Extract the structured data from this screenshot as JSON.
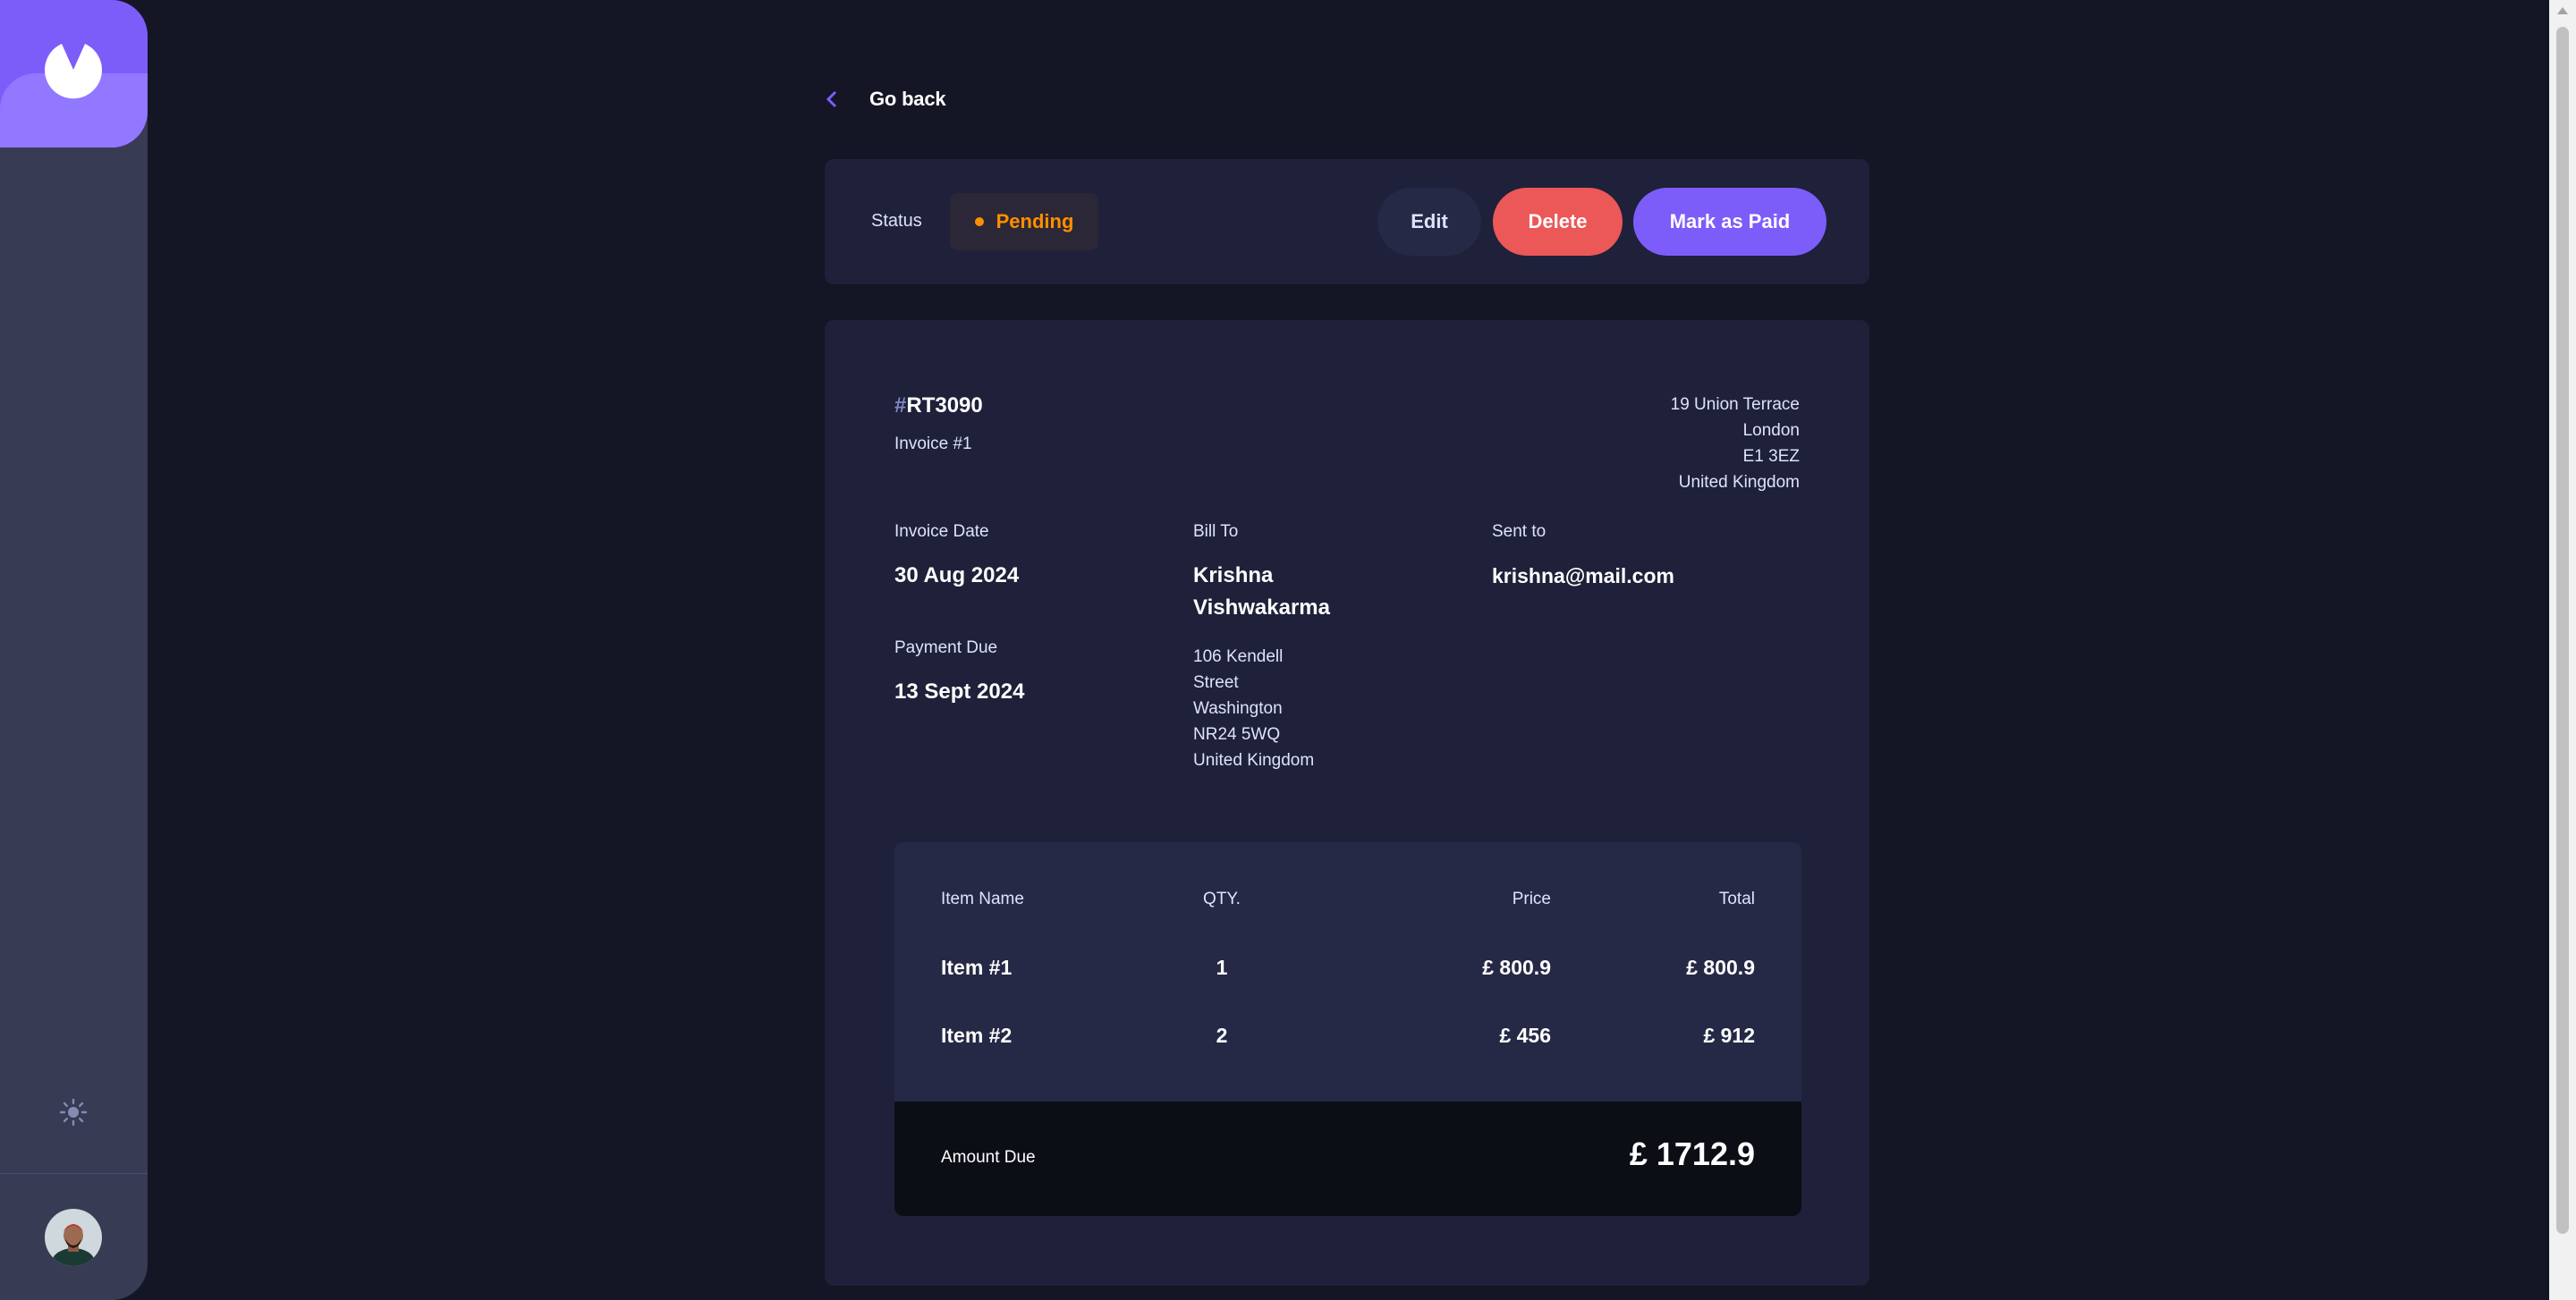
{
  "nav": {
    "go_back_label": "Go back"
  },
  "status": {
    "label": "Status",
    "value": "Pending",
    "color": "#ff8f00"
  },
  "actions": {
    "edit_label": "Edit",
    "delete_label": "Delete",
    "mark_paid_label": "Mark as Paid"
  },
  "invoice": {
    "id_prefix": "#",
    "id": "RT3090",
    "description": "Invoice #1",
    "sender_address": {
      "street": "19 Union Terrace",
      "city": "London",
      "post_code": "E1 3EZ",
      "country": "United Kingdom"
    },
    "invoice_date_label": "Invoice Date",
    "invoice_date": "30 Aug 2024",
    "payment_due_label": "Payment Due",
    "payment_due": "13 Sept 2024",
    "bill_to_label": "Bill To",
    "client_name_line1": "Krishna",
    "client_name_line2": "Vishwakarma",
    "client_address": {
      "street_line1": "106 Kendell",
      "street_line2": "Street",
      "city": "Washington",
      "post_code": "NR24 5WQ",
      "country": "United Kingdom"
    },
    "sent_to_label": "Sent to",
    "client_email": "krishna@mail.com"
  },
  "items": {
    "headers": {
      "name": "Item Name",
      "qty": "QTY.",
      "price": "Price",
      "total": "Total"
    },
    "rows": [
      {
        "name": "Item #1",
        "qty": "1",
        "price": "£ 800.9",
        "total": "£ 800.9"
      },
      {
        "name": "Item #2",
        "qty": "2",
        "price": "£ 456",
        "total": "£ 912"
      }
    ],
    "amount_due_label": "Amount Due",
    "amount_due": "£ 1712.9"
  },
  "sidebar": {
    "logo_icon": "logo-icon",
    "theme_icon": "sun-icon",
    "avatar_icon": "avatar"
  },
  "colors": {
    "background": "#141625",
    "card": "#1e2139",
    "accent": "#7c5dfa",
    "danger": "#ec5757",
    "pending": "#ff8f00"
  }
}
